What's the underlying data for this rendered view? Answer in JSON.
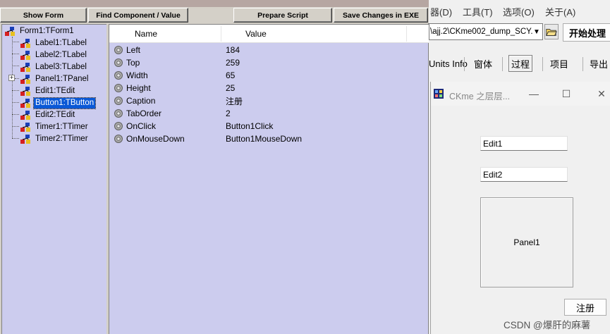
{
  "toolbar": {
    "show_form": "Show Form",
    "find_component": "Find Component / Value",
    "prepare_script": "Prepare Script",
    "save_changes": "Save Changes in EXE"
  },
  "tree": {
    "items": [
      {
        "label": "Form1:TForm1"
      },
      {
        "label": "Label1:TLabel"
      },
      {
        "label": "Label2:TLabel"
      },
      {
        "label": "Label3:TLabel"
      },
      {
        "label": "Panel1:TPanel",
        "expandable": true
      },
      {
        "label": "Edit1:TEdit"
      },
      {
        "label": "Button1:TButton",
        "selected": true
      },
      {
        "label": "Edit2:TEdit"
      },
      {
        "label": "Timer1:TTimer"
      },
      {
        "label": "Timer2:TTimer"
      }
    ]
  },
  "grid": {
    "header_name": "Name",
    "header_value": "Value",
    "rows": [
      {
        "name": "Left",
        "value": "184"
      },
      {
        "name": "Top",
        "value": "259"
      },
      {
        "name": "Width",
        "value": "65"
      },
      {
        "name": "Height",
        "value": "25"
      },
      {
        "name": "Caption",
        "value": "注册"
      },
      {
        "name": "TabOrder",
        "value": "2"
      },
      {
        "name": "OnClick",
        "value": "Button1Click"
      },
      {
        "name": "OnMouseDown",
        "value": "Button1MouseDown"
      }
    ]
  },
  "ide": {
    "menu": [
      "器(D)",
      "工具(T)",
      "选项(O)",
      "关于(A)"
    ],
    "path_value": "\\ajj.2\\CKme002_dump_SCY.",
    "start_button": "开始处理",
    "tabs": [
      "Units Info",
      "窗体",
      "过程",
      "项目",
      "导出"
    ],
    "active_tab": "过程"
  },
  "form_window": {
    "title": "CKme 之层层...",
    "edit1": "Edit1",
    "edit2": "Edit2",
    "panel": "Panel1",
    "button": "注册"
  },
  "watermark": "CSDN @爆肝的麻薯",
  "colors": {
    "tree_background": "#ccccee",
    "selection": "#0a58d6",
    "chrome": "#d4d0c8"
  }
}
